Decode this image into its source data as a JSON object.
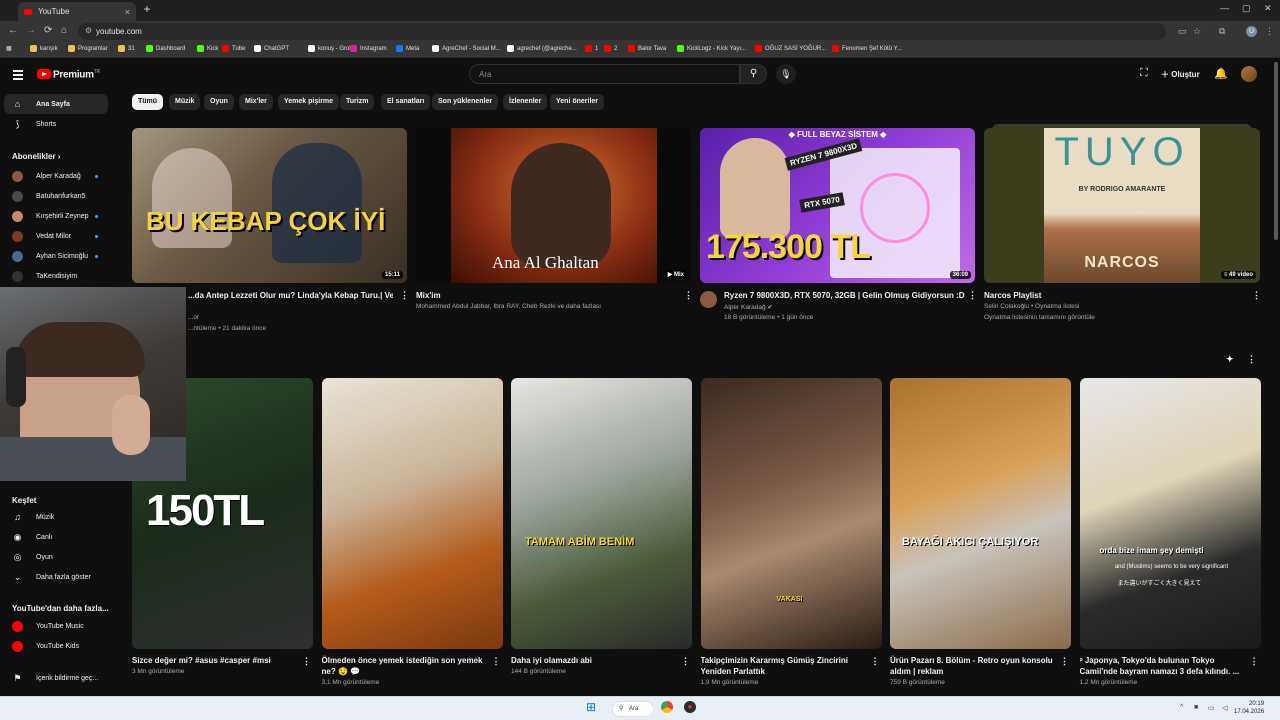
{
  "browser": {
    "tab_title": "YouTube",
    "url": "youtube.com",
    "bookmarks": [
      {
        "label": "karışık",
        "color": "#f0c060"
      },
      {
        "label": "Programlar",
        "color": "#f0c060"
      },
      {
        "label": "31",
        "color": "#f0c060"
      },
      {
        "label": "Dashboard",
        "color": "#53fc18"
      },
      {
        "label": "Kick",
        "color": "#53fc18"
      },
      {
        "label": "Tube",
        "color": "#ff0000"
      },
      {
        "label": "ChatGPT",
        "color": "#ffffff"
      },
      {
        "label": "konuş - Grok",
        "color": "#ffffff"
      },
      {
        "label": "Instagram",
        "color": "#d6249f"
      },
      {
        "label": "Meta",
        "color": "#1877f2"
      },
      {
        "label": "AgreChef - Social M...",
        "color": "#ffffff"
      },
      {
        "label": "agrechef (@agreche...",
        "color": "#ffffff"
      },
      {
        "label": "1",
        "color": "#ff0000"
      },
      {
        "label": "2",
        "color": "#ff0000"
      },
      {
        "label": "Balor Tava",
        "color": "#ff0000"
      },
      {
        "label": "KickLogz - Kick Yayı...",
        "color": "#53fc18"
      },
      {
        "label": "OĞUZ SASİ YOĞUR...",
        "color": "#ff0000"
      },
      {
        "label": "Fenomen Şef Kötü Y...",
        "color": "#ff0000"
      }
    ]
  },
  "header": {
    "brand": "Premium",
    "brand_sup": "TR",
    "search_placeholder": "Ara",
    "create_label": "Oluştur"
  },
  "sidebar": {
    "home": "Ana Sayfa",
    "shorts": "Shorts",
    "subscriptions_heading": "Abonelikler",
    "subscriptions": [
      {
        "name": "Alper Karadağ",
        "dot": true,
        "color": "#8a5a44"
      },
      {
        "name": "Batuhanfurkan5",
        "dot": false,
        "color": "#4a4a4a"
      },
      {
        "name": "Kırşehirli Zeynep",
        "dot": true,
        "color": "#c48a6a"
      },
      {
        "name": "Vedat Milor",
        "dot": true,
        "color": "#7a3a2a"
      },
      {
        "name": "Ayhan Sicimoğlu",
        "dot": true,
        "color": "#4a6a8a"
      },
      {
        "name": "TaKendisiyim",
        "dot": false,
        "color": "#333333"
      }
    ],
    "explore_heading": "Keşfet",
    "explore": [
      {
        "label": "Müzik",
        "icon": "music-note-icon",
        "glyph": "♫"
      },
      {
        "label": "Canlı",
        "icon": "live-icon",
        "glyph": "◉"
      },
      {
        "label": "Oyun",
        "icon": "gamepad-icon",
        "glyph": "◎"
      },
      {
        "label": "Daha fazla göster",
        "icon": "chevron-down-icon",
        "glyph": "⌄"
      }
    ],
    "more_heading": "YouTube'dan daha fazla...",
    "more": [
      {
        "label": "YouTube Music",
        "color": "#ff0000"
      },
      {
        "label": "YouTube Kids",
        "color": "#ff0000"
      }
    ],
    "report": "İçerik bildirme geç..."
  },
  "chips": [
    "Tümü",
    "Müzik",
    "Oyun",
    "Mix'ler",
    "Yemek pişirme",
    "Turizm",
    "El sanatları",
    "Son yüklenenler",
    "İzlenenler",
    "Yeni öneriler"
  ],
  "videos_row1": [
    {
      "title": "...da Antep Lezzeti Olur mu? Linda'yla Kebap Turu.| Vedat",
      "channel": "...or",
      "stats": "...ntüleme • 21 dakika önce",
      "duration": "15:11",
      "overlay": "BU KEBAP ÇOK İYİ"
    },
    {
      "title": "Mix'im",
      "channel": "Mohammed Abdul Jabbar, Ibra RAY, Cheb Rezki ve daha fazlası",
      "stats": "",
      "duration": "Mix",
      "overlay": "Ana Al Ghaltan"
    },
    {
      "title": "Ryzen 7 9800X3D, RTX 5070, 32GB | Gelin Olmuş Gidiyorsun :D",
      "channel": "Alper Karadağ",
      "stats": "18 B görüntüleme • 1 gün önce",
      "duration": "36:09",
      "overlay": "175.300 TL",
      "top_overlay": "◆ FULL BEYAZ SİSTEM ◆",
      "tag1": "RYZEN 7 9800X3D",
      "tag2": "RTX 5070"
    },
    {
      "title": "Narcos Playlist",
      "channel": "Selin Colakoğlu • Oynatma listesi",
      "stats": "Oynatma listesinin tamamını görüntüle",
      "duration": "49 video",
      "overlay": "TUYO",
      "sub1": "BY RODRIGO AMARANTE",
      "sub2": "NARCOS"
    }
  ],
  "shorts_row": [
    {
      "title": "Sizce değer mi? #asus #casper #msi",
      "views": "3 Mn görüntüleme",
      "overlay": "150TL"
    },
    {
      "title": "Ölmeden önce yemek istediğin son yemek ne? 🤤 💬",
      "views": "3,1 Mn görüntüleme",
      "overlay": ""
    },
    {
      "title": "Daha iyi olamazdı abi",
      "views": "144 B görüntüleme",
      "overlay": "TAMAM ABİM BENİM"
    },
    {
      "title": "Takipçimizin Kararmış Gümüş Zincirini Yeniden Parlattık",
      "views": "1,9 Mn görüntüleme",
      "overlay": "VAKASI"
    },
    {
      "title": "Ürün Pazarı 8. Bölüm - Retro oyun konsolu aldım | reklam",
      "views": "759 B görüntüleme",
      "overlay": "BAYAĞI AKICI ÇALIŞIYOR"
    },
    {
      "title": "ᵖ Japonya, Tokyo'da bulunan Tokyo Camii'nde bayram namazı 3 defa kılındı. ...",
      "views": "1,2 Mn görüntüleme",
      "overlay": "orda bize imam şey demişti",
      "sub1": "and (Muslims) seems to be very significant",
      "sub2": "また違いがすごく大きく見えて"
    }
  ],
  "taskbar": {
    "search": "Ara",
    "time": "20:19",
    "date": "17.04.2026"
  }
}
